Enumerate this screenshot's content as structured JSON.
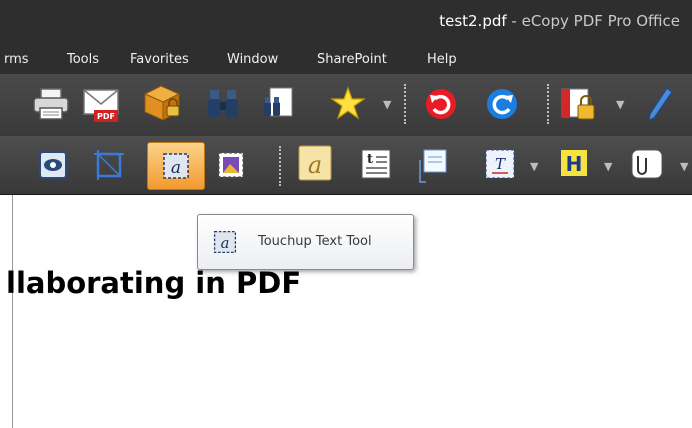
{
  "window": {
    "filename": "test2.pdf",
    "app_title": " - eCopy PDF Pro Office"
  },
  "menu": {
    "items": [
      {
        "label": "rms"
      },
      {
        "label": "Tools"
      },
      {
        "label": "Favorites"
      },
      {
        "label": "Window"
      },
      {
        "label": "SharePoint"
      },
      {
        "label": "Help"
      }
    ]
  },
  "toolbar1": {
    "icons": [
      "print-icon",
      "email-pdf-icon",
      "secure-package-icon",
      "binoculars-search-icon",
      "find-in-document-icon",
      "favorites-star-icon",
      "undo-icon",
      "redo-icon",
      "security-lock-icon",
      "pencil-icon"
    ]
  },
  "toolbar2": {
    "icons": [
      "view-icon",
      "crop-tool-icon",
      "touchup-text-tool-icon",
      "touchup-image-tool-icon",
      "typewriter-icon",
      "text-box-icon",
      "note-icon",
      "text-edit-icon",
      "highlight-icon",
      "attach-icon"
    ],
    "active_tool": "touchup-text-tool"
  },
  "tooltip": {
    "label": "Touchup Text Tool"
  },
  "document": {
    "heading": "llaborating in PDF"
  },
  "colors": {
    "chrome_dark": "#2e2e2e",
    "active_button": "#f4a640",
    "tooltip_bg": "#f4f5f8"
  }
}
